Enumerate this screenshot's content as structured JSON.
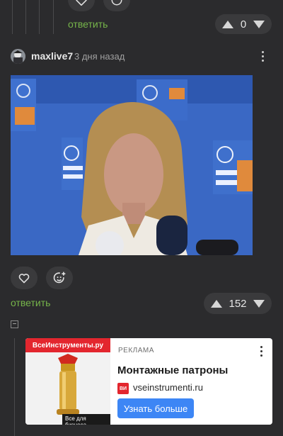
{
  "prev_comment": {
    "reply_label": "ответить",
    "score": "0"
  },
  "comment": {
    "author": "maxlive7",
    "time": "3 дня назад",
    "reply_label": "ответить",
    "score": "152",
    "collapse_symbol": "−"
  },
  "ad": {
    "brand_banner": "ВсеИнструменты.ру",
    "business_tag": "Все для бизнеса",
    "label": "РЕКЛАМА",
    "title": "Монтажные патроны",
    "domain": "vseinstrumenti.ru",
    "favicon_text": "ВИ",
    "cta": "Узнать больше"
  },
  "icons": {
    "heart": "heart-icon",
    "emoji": "emoji-add-icon",
    "up": "upvote-icon",
    "down": "downvote-icon",
    "more": "more-icon"
  },
  "colors": {
    "background": "#2b2b2d",
    "accent_green": "#76b54a",
    "ad_red": "#e3262e",
    "ad_button": "#3d86f5"
  }
}
